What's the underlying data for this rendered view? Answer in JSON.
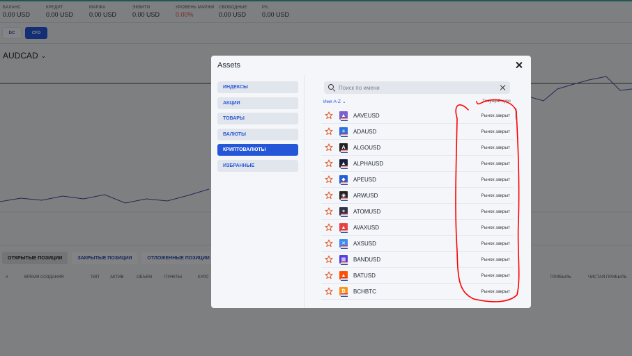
{
  "account_stats": [
    {
      "label": "Баланс",
      "value": "0.00 USD",
      "color": "#333333"
    },
    {
      "label": "Кредит",
      "value": "0.00 USD",
      "color": "#333333"
    },
    {
      "label": "Маржа",
      "value": "0.00 USD",
      "color": "#333333"
    },
    {
      "label": "Эквити",
      "value": "0.00 USD",
      "color": "#333333"
    },
    {
      "label": "Уровень маржи",
      "value": "0.00%",
      "color": "#d9534f"
    },
    {
      "label": "Свободные",
      "value": "0.00 USD",
      "color": "#333333"
    },
    {
      "label": "P/L",
      "value": "0.00 USD",
      "color": "#333333"
    }
  ],
  "mode_tabs": {
    "dc": "DC",
    "cfd": "CFD"
  },
  "symbol": "AUDCAD",
  "position_tabs": [
    "Открытые позиции",
    "Закрытые позиции",
    "Отложенные позиции"
  ],
  "table_headers": [
    "#",
    "Время создания",
    "Тип",
    "Актив",
    "Объем",
    "Пункты",
    "Курс",
    "Прибыль",
    "Чистая прибыль"
  ],
  "modal": {
    "title": "Assets",
    "categories": [
      {
        "label": "Индексы",
        "active": false
      },
      {
        "label": "Акции",
        "active": false
      },
      {
        "label": "Товары",
        "active": false
      },
      {
        "label": "Валюты",
        "active": false
      },
      {
        "label": "Криптовалюты",
        "active": true
      },
      {
        "label": "Избранные",
        "active": false
      }
    ],
    "search_placeholder": "Поиск по имени",
    "sort_label": "Имя А-Z",
    "rate_header": "Текущий курс",
    "assets": [
      {
        "symbol": "AAVEUSD",
        "rate": "Рынок закрыт",
        "icon": "aave-icon",
        "color": "#7a5fd0",
        "glyph": "▲"
      },
      {
        "symbol": "ADAUSD",
        "rate": "Рынок закрыт",
        "icon": "cardano-icon",
        "color": "#2a6fe0",
        "glyph": "✳"
      },
      {
        "symbol": "ALGOUSD",
        "rate": "Рынок закрыт",
        "icon": "algorand-icon",
        "color": "#222222",
        "glyph": "A"
      },
      {
        "symbol": "ALPHAUSD",
        "rate": "Рынок закрыт",
        "icon": "alpha-icon",
        "color": "#16203a",
        "glyph": "▲"
      },
      {
        "symbol": "APEUSD",
        "rate": "Рынок закрыт",
        "icon": "apecoin-icon",
        "color": "#1f5fd6",
        "glyph": "◆"
      },
      {
        "symbol": "ARWUSD",
        "rate": "Рынок закрыт",
        "icon": "arweave-icon",
        "color": "#222222",
        "glyph": "◉"
      },
      {
        "symbol": "ATOMUSD",
        "rate": "Рынок закрыт",
        "icon": "cosmos-icon",
        "color": "#2e3148",
        "glyph": "✶"
      },
      {
        "symbol": "AVAXUSD",
        "rate": "Рынок закрыт",
        "icon": "avalanche-icon",
        "color": "#e84142",
        "glyph": "▲"
      },
      {
        "symbol": "AXSUSD",
        "rate": "Рынок закрыт",
        "icon": "axie-icon",
        "color": "#3d8bf2",
        "glyph": "✕"
      },
      {
        "symbol": "BANDUSD",
        "rate": "Рынок закрыт",
        "icon": "band-icon",
        "color": "#4f3fe0",
        "glyph": "▦"
      },
      {
        "symbol": "BATUSD",
        "rate": "Рынок закрыт",
        "icon": "bat-icon",
        "color": "#ff5000",
        "glyph": "▲"
      },
      {
        "symbol": "BCHBTC",
        "rate": "Рынок закрыт",
        "icon": "bitcoin-cash-icon",
        "color": "#f7931a",
        "glyph": "₿"
      }
    ]
  },
  "colors": {
    "accent": "#2456d8",
    "star": "#e0542a",
    "annotation": "#ff0000"
  }
}
